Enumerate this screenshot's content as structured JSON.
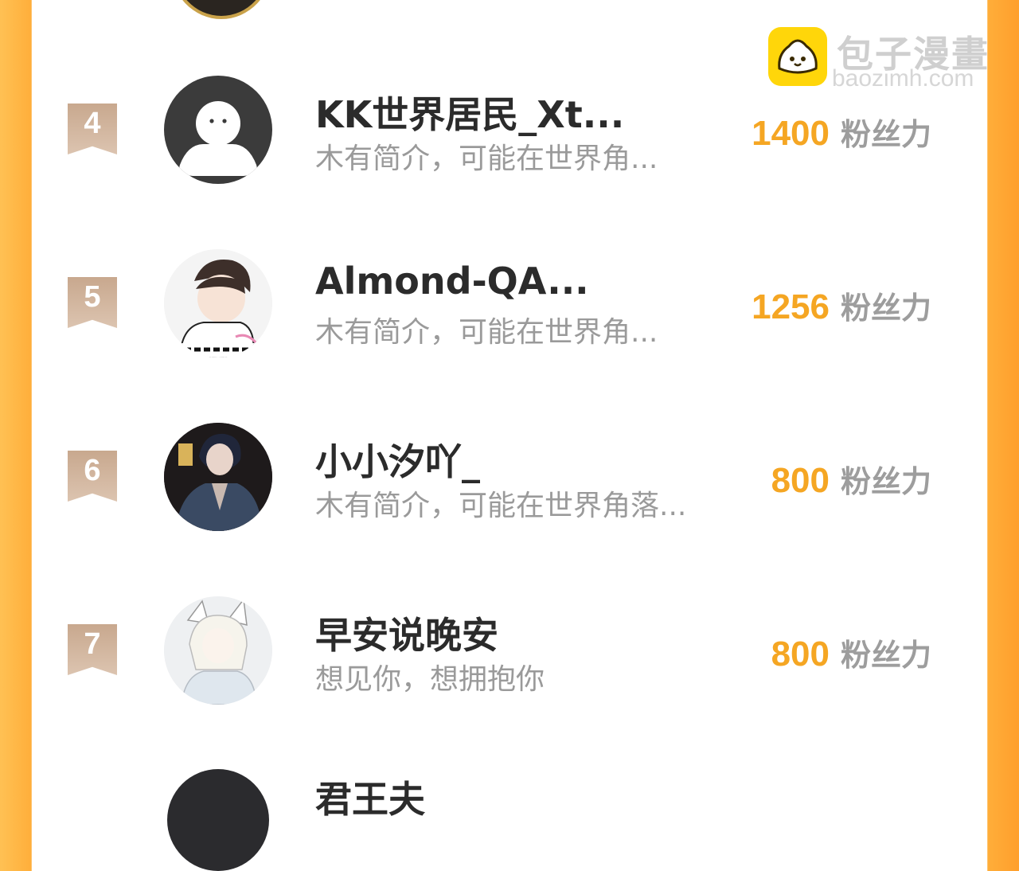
{
  "watermark": {
    "title": "包子漫畫",
    "url": "baozimh.com"
  },
  "fans_unit": "粉丝力",
  "rows": [
    {
      "rank": "4",
      "name": "KK世界居民_Xt...",
      "intro": "木有简介，可能在世界角...",
      "fans": "1400"
    },
    {
      "rank": "5",
      "name": "Almond-QA...",
      "intro": "木有简介，可能在世界角...",
      "fans": "1256"
    },
    {
      "rank": "6",
      "name": "小小汐吖_",
      "intro": "木有简介，可能在世界角落...",
      "fans": "800"
    },
    {
      "rank": "7",
      "name": "早安说晚安",
      "intro": "想见你，想拥抱你",
      "fans": "800"
    }
  ],
  "partial_next": {
    "name": "君王夫"
  }
}
